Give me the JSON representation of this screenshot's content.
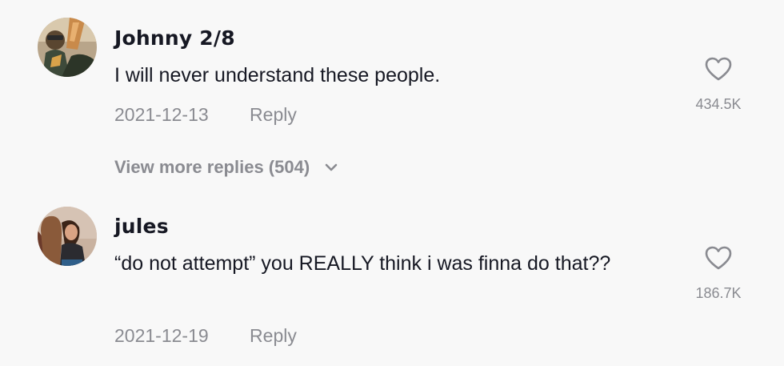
{
  "comments": [
    {
      "username": "Johnny 2/8",
      "text": "I will never understand these people.",
      "date": "2021-12-13",
      "reply_label": "Reply",
      "likes": "434.5K",
      "view_more": "View more replies (504)"
    },
    {
      "username": "jules",
      "text": "“do not attempt” you REALLY think i was finna do that??",
      "date": "2021-12-19",
      "reply_label": "Reply",
      "likes": "186.7K"
    }
  ],
  "colors": {
    "background": "#f8f8f8",
    "primary_text": "#161823",
    "secondary_text": "#8a8b91"
  },
  "icons": {
    "like": "heart-outline-icon",
    "expand": "chevron-down-icon"
  }
}
